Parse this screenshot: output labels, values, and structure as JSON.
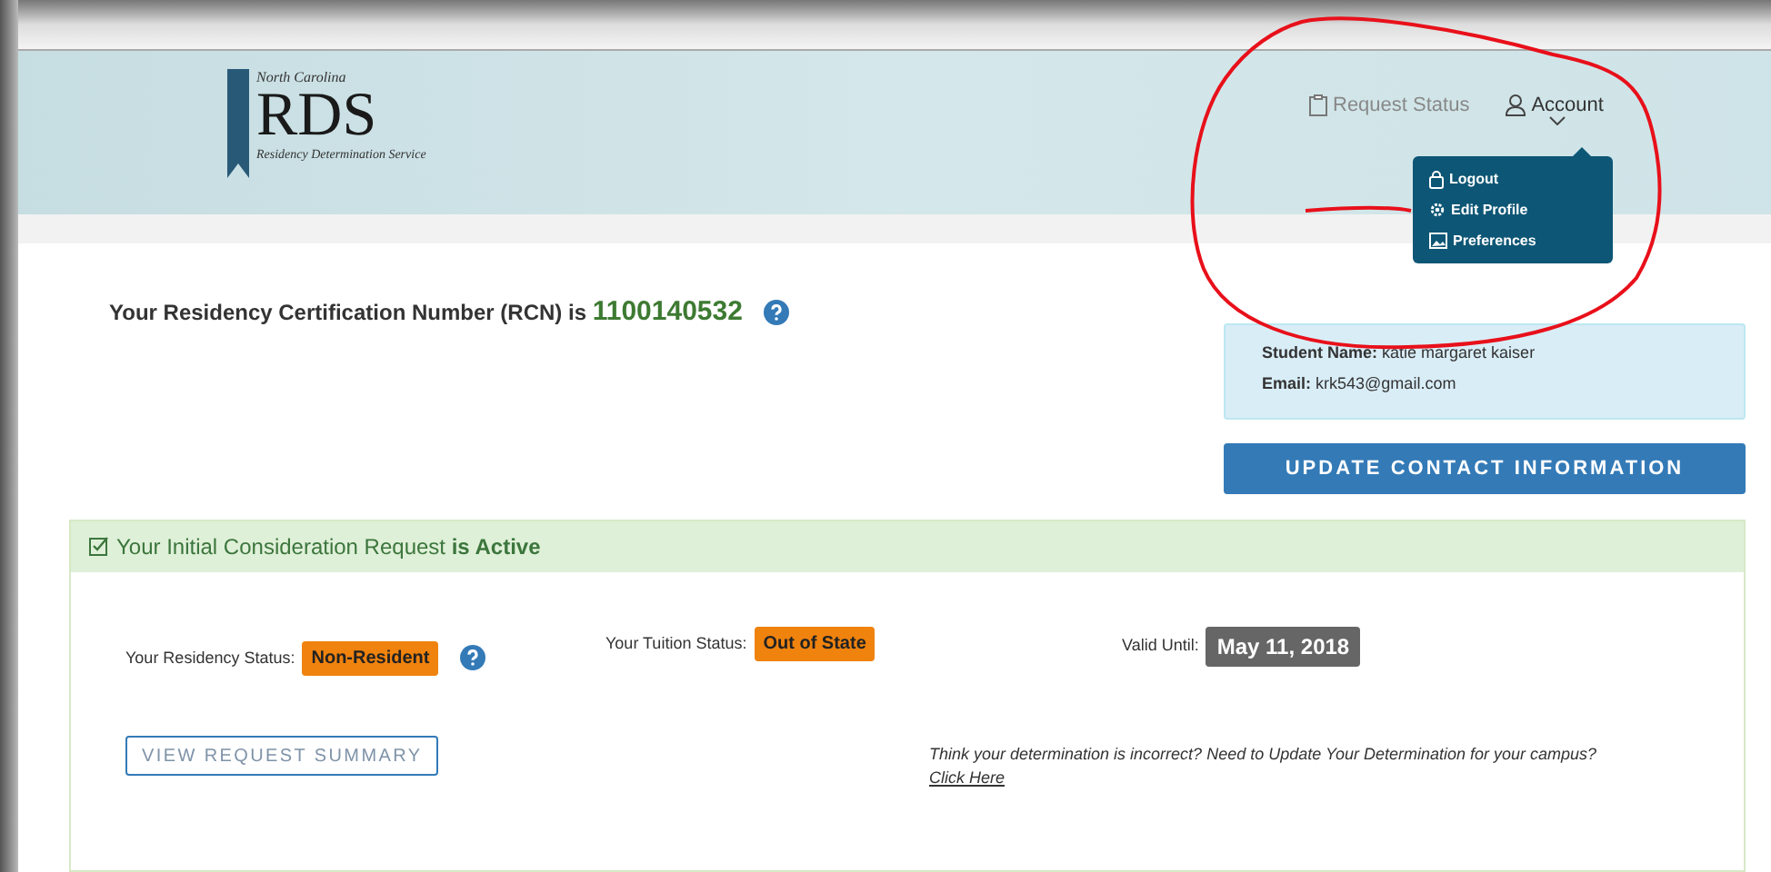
{
  "header": {
    "logo": {
      "state_line": "North Carolina",
      "name": "RDS",
      "tagline": "Residency Determination Service"
    },
    "nav": [
      {
        "kind": "status",
        "label": "Request Status",
        "expanded": false
      },
      {
        "kind": "account",
        "label": "Account",
        "expanded": true
      }
    ],
    "account_menu": [
      {
        "kind": "lock",
        "label": "Logout"
      },
      {
        "kind": "gear",
        "label": "Edit Profile"
      },
      {
        "kind": "image",
        "label": "Preferences"
      }
    ]
  },
  "rcn": {
    "prefix": "Your Residency Certification Number (RCN) is",
    "number": "1100140532"
  },
  "student": [
    {
      "label": "Student Name:",
      "value": "katie margaret kaiser"
    },
    {
      "label": "Email:",
      "value": "krk543@gmail.com"
    }
  ],
  "update_button": "UPDATE CONTACT INFORMATION",
  "request": {
    "heading": "Your Initial Consideration Request **is Active**",
    "statuses": [
      {
        "label": "Your Residency Status:",
        "value": "Non-Resident",
        "kind": "warning",
        "help": true
      },
      {
        "label": "Your Tuition Status:",
        "value": "Out of State",
        "kind": "warning",
        "help": false
      },
      {
        "label": "Valid Until:",
        "value": "May 11, 2018",
        "kind": "date",
        "help": false
      }
    ],
    "summary_button": "VIEW REQUEST SUMMARY",
    "note": "Think your determination is incorrect? Need to Update Your Determination for your campus?",
    "note_link": "Click Here"
  }
}
